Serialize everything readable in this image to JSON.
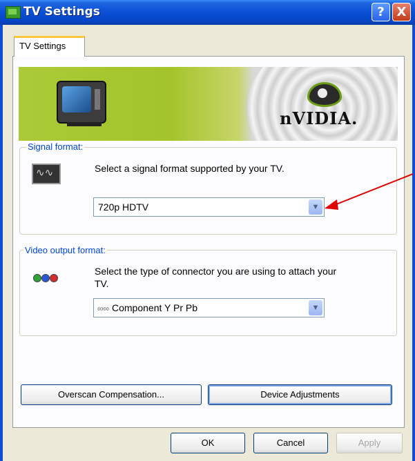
{
  "window": {
    "title": "TV Settings"
  },
  "title_buttons": {
    "help": "?",
    "close": "X"
  },
  "tabs": [
    {
      "label": "TV Settings"
    }
  ],
  "banner": {
    "brand": "nVIDIA."
  },
  "signal_format": {
    "group_label": "Signal format:",
    "description": "Select a signal format supported by your TV.",
    "selected": "720p HDTV"
  },
  "video_output_format": {
    "group_label": "Video output format:",
    "description_line1": "Select the type of connector you are using to attach your",
    "description_line2": "TV.",
    "selected_icon": "∞∞",
    "selected": "Component Y Pr Pb"
  },
  "buttons": {
    "overscan": "Overscan Compensation...",
    "device_adjustments": "Device Adjustments",
    "ok": "OK",
    "cancel": "Cancel",
    "apply": "Apply"
  },
  "icons": {
    "tv": "television-icon",
    "signal": "signal-waveform-icon",
    "connector": "rgb-connector-icon",
    "dropdown": "chevron-down-icon"
  },
  "colors": {
    "titlebar": "#0a4fd6",
    "group_label": "#0046d5",
    "annotation_arrow": "#e00000",
    "tab_highlight": "#ffc83c",
    "nvidia_green": "#76b900"
  },
  "states": {
    "apply_enabled": false
  }
}
